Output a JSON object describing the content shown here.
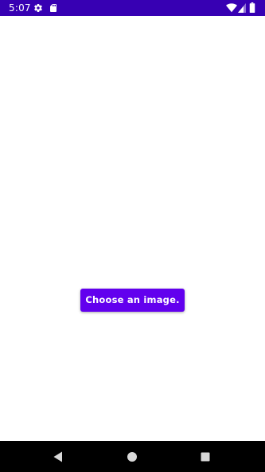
{
  "status_bar": {
    "time": "5:07",
    "background": "#3700b3",
    "icons": [
      "gear-icon",
      "sd-card-icon",
      "wifi-icon",
      "signal-icon",
      "battery-icon"
    ]
  },
  "main": {
    "choose_button_label": "Choose an image.",
    "accent": "#6200ee"
  },
  "nav_bar": {
    "buttons": [
      "back-icon",
      "home-icon",
      "recents-icon"
    ]
  }
}
